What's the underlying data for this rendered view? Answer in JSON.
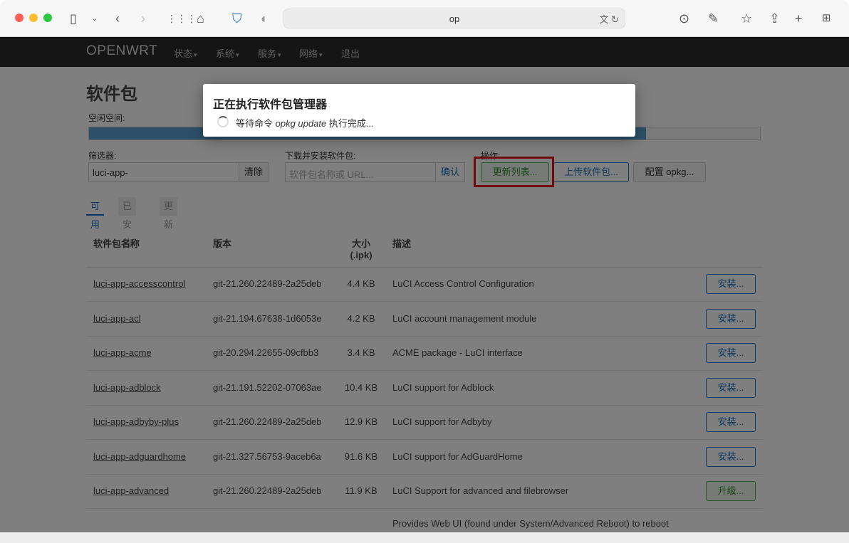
{
  "browser": {
    "url": "op",
    "icons": [
      "sidebar-icon",
      "chevron-down-icon",
      "back-icon",
      "forward-icon",
      "grid-icon",
      "home-icon",
      "shield-icon",
      "privacy-icon",
      "translate-icon",
      "reload-icon",
      "download-icon",
      "edit-icon",
      "star-icon",
      "share-icon",
      "plus-icon",
      "tabs-icon"
    ]
  },
  "nav": {
    "brand": "OPENWRT",
    "items": [
      "状态",
      "系统",
      "服务",
      "网络",
      "退出"
    ]
  },
  "page": {
    "title": "软件包",
    "free_space_label": "空闲空间:",
    "free_space_fraction": 0.83,
    "filter_label": "筛选器:",
    "filter_value": "luci-app-",
    "clear_label": "清除",
    "download_label": "下载并安装软件包:",
    "download_placeholder": "软件包名称或 URL...",
    "confirm_label": "确认",
    "actions_label": "操作:",
    "update_lists_label": "更新列表...",
    "upload_label": "上传软件包...",
    "configure_label": "配置 opkg...",
    "tabs": [
      "可用",
      "已安装",
      "更新"
    ]
  },
  "table": {
    "headers": {
      "name": "软件包名称",
      "version": "版本",
      "size_line1": "大小",
      "size_line2": "(.ipk)",
      "description": "描述"
    },
    "rows": [
      {
        "name": "luci-app-accesscontrol",
        "version": "git-21.260.22489-2a25deb",
        "size": "4.4 KB",
        "desc": "LuCI Access Control Configuration",
        "action": "安装..."
      },
      {
        "name": "luci-app-acl",
        "version": "git-21.194.67638-1d6053e",
        "size": "4.2 KB",
        "desc": "LuCI account management module",
        "action": "安装..."
      },
      {
        "name": "luci-app-acme",
        "version": "git-20.294.22655-09cfbb3",
        "size": "3.4 KB",
        "desc": "ACME package - LuCI interface",
        "action": "安装..."
      },
      {
        "name": "luci-app-adblock",
        "version": "git-21.191.52202-07063ae",
        "size": "10.4 KB",
        "desc": "LuCI support for Adblock",
        "action": "安装..."
      },
      {
        "name": "luci-app-adbyby-plus",
        "version": "git-21.260.22489-2a25deb",
        "size": "12.9 KB",
        "desc": "LuCI support for Adbyby",
        "action": "安装..."
      },
      {
        "name": "luci-app-adguardhome",
        "version": "git-21.327.56753-9aceb6a",
        "size": "91.6 KB",
        "desc": "LuCI support for AdGuardHome",
        "action": "安装..."
      },
      {
        "name": "luci-app-advanced",
        "version": "git-21.260.22489-2a25deb",
        "size": "11.9 KB",
        "desc": "LuCI Support for advanced and filebrowser",
        "action": "升级..."
      }
    ],
    "partial_row_desc": "Provides Web UI (found under System/Advanced Reboot) to reboot"
  },
  "modal": {
    "title": "正在执行软件包管理器",
    "body_prefix": "等待命令 ",
    "body_command": "opkg update",
    "body_suffix": " 执行完成..."
  },
  "colors": {
    "nav_bg": "#2a2a2a",
    "accent_blue": "#1a6fbf",
    "highlight_red": "#e0141e",
    "upgrade_green": "#4caf50"
  }
}
